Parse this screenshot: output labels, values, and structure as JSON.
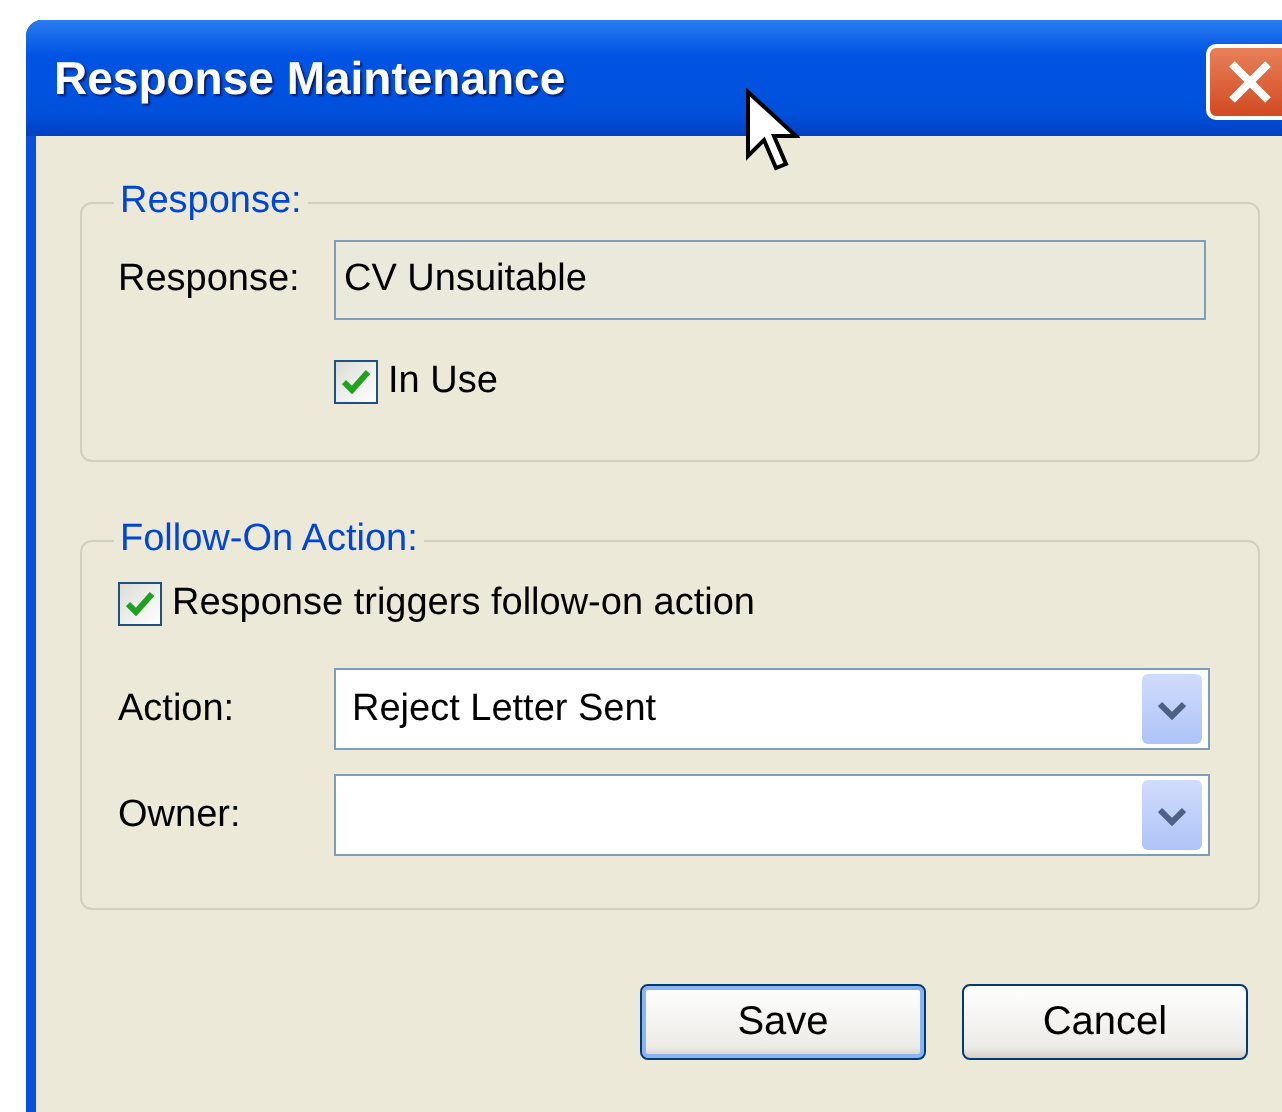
{
  "window": {
    "title": "Response Maintenance"
  },
  "response_group": {
    "legend": "Response:",
    "label": "Response:",
    "value": "CV Unsuitable",
    "in_use": {
      "label": "In Use",
      "checked": true
    }
  },
  "follow_on_group": {
    "legend": "Follow-On Action:",
    "trigger": {
      "label": "Response triggers follow-on action",
      "checked": true
    },
    "fields": [
      {
        "label": "Action:",
        "value": "Reject Letter Sent"
      },
      {
        "label": "Owner:"
      }
    ]
  },
  "buttons": [
    {
      "label": "Save",
      "default": true
    },
    {
      "label": "Cancel",
      "default": false
    }
  ]
}
